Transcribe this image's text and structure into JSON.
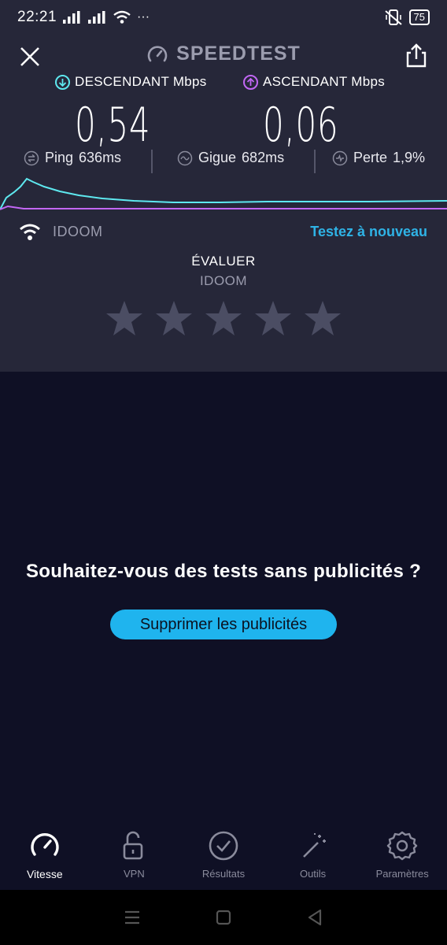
{
  "status_bar": {
    "time": "22:21",
    "more": "···",
    "battery": "75"
  },
  "header": {
    "brand": "SPEEDTEST"
  },
  "speeds": {
    "download_label": "DESCENDANT Mbps",
    "upload_label": "ASCENDANT Mbps",
    "download_value": "0,54",
    "upload_value": "0,06"
  },
  "metrics": {
    "ping_label": "Ping",
    "ping_value": "636ms",
    "jitter_label": "Gigue",
    "jitter_value": "682ms",
    "loss_label": "Perte",
    "loss_value": "1,9%"
  },
  "isp": {
    "name": "IDOOM",
    "retest": "Testez à nouveau"
  },
  "rating": {
    "title": "ÉVALUER",
    "isp": "IDOOM",
    "stars_total": 5,
    "stars_filled": 0
  },
  "ad": {
    "question": "Souhaitez-vous des tests sans publicités ?",
    "button": "Supprimer les publicités"
  },
  "nav": {
    "items": [
      {
        "label": "Vitesse",
        "icon": "speedometer-icon",
        "active": true
      },
      {
        "label": "VPN",
        "icon": "lock-open-icon",
        "active": false
      },
      {
        "label": "Résultats",
        "icon": "check-circle-icon",
        "active": false
      },
      {
        "label": "Outils",
        "icon": "magic-wand-icon",
        "active": false
      },
      {
        "label": "Paramètres",
        "icon": "gear-icon",
        "active": false
      }
    ]
  },
  "colors": {
    "download": "#5ee8ef",
    "upload": "#c267f5",
    "accent": "#1fb4ee",
    "panel": "#262739",
    "background": "#0f1025"
  }
}
